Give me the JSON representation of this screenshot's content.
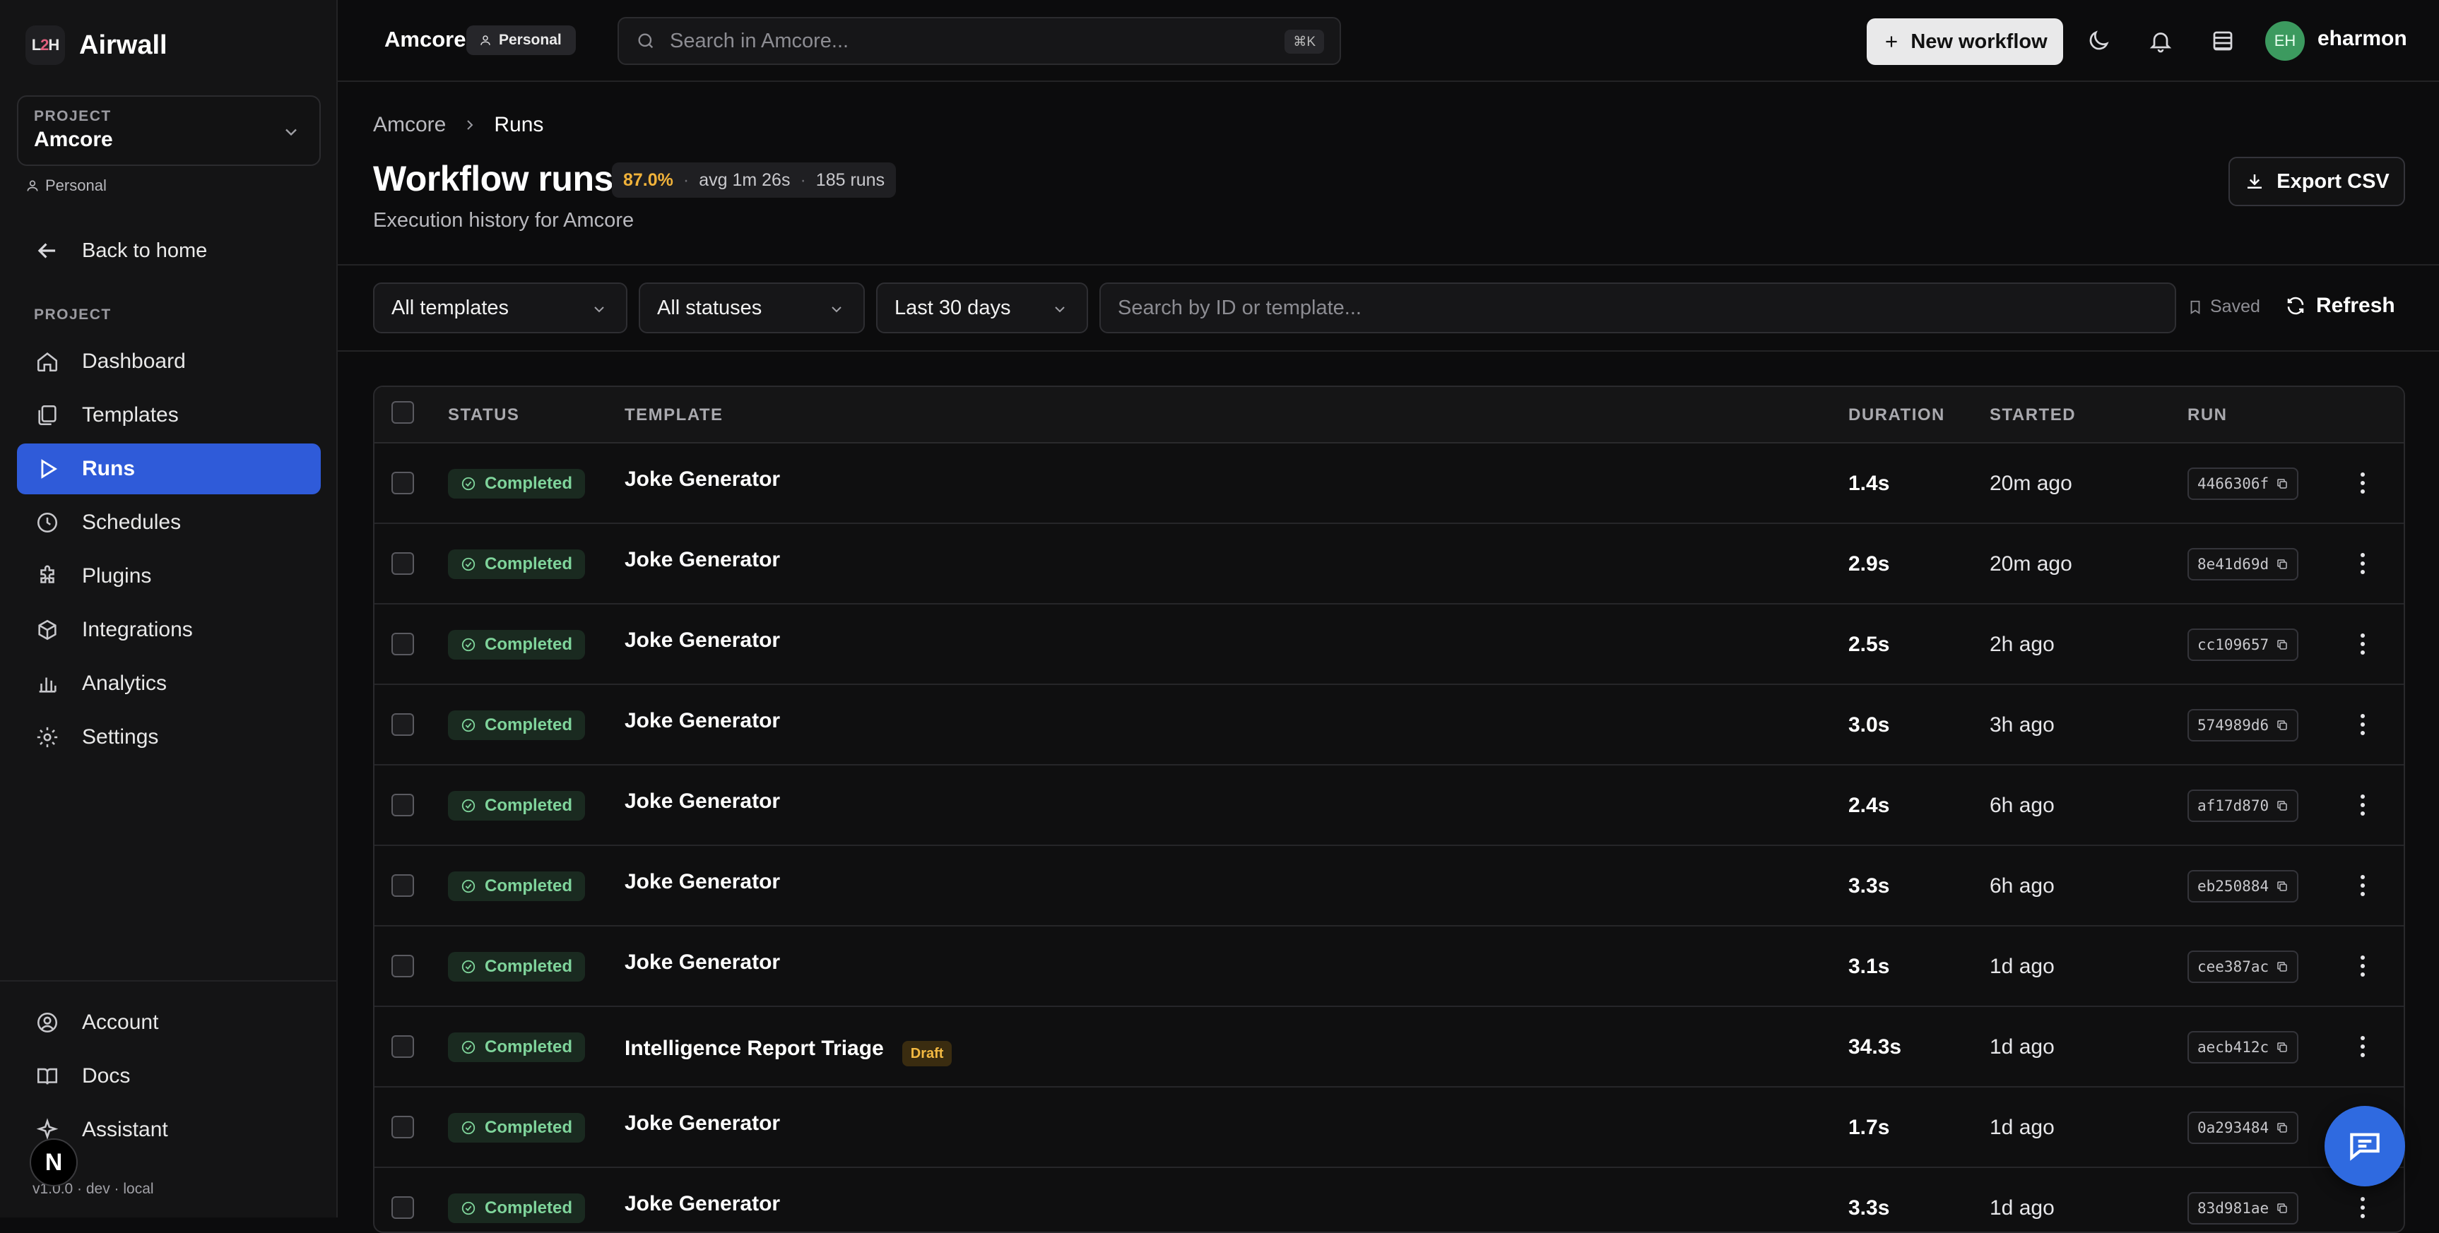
{
  "brand": {
    "logo_text": "L2H",
    "name": "Airwall"
  },
  "project_selector": {
    "label": "PROJECT",
    "value": "Amcore",
    "scope": "Personal"
  },
  "sidebar": {
    "back_label": "Back to home",
    "section_label": "PROJECT",
    "items": [
      {
        "label": "Dashboard",
        "icon": "home-icon"
      },
      {
        "label": "Templates",
        "icon": "templates-icon"
      },
      {
        "label": "Runs",
        "icon": "play-icon",
        "active": true
      },
      {
        "label": "Schedules",
        "icon": "clock-icon"
      },
      {
        "label": "Plugins",
        "icon": "puzzle-icon"
      },
      {
        "label": "Integrations",
        "icon": "cube-icon"
      },
      {
        "label": "Analytics",
        "icon": "bar-chart-icon"
      },
      {
        "label": "Settings",
        "icon": "gear-icon"
      }
    ],
    "bottom_items": [
      {
        "label": "Account",
        "icon": "user-circle-icon"
      },
      {
        "label": "Docs",
        "icon": "book-icon"
      },
      {
        "label": "Assistant",
        "icon": "sparkle-icon"
      }
    ],
    "version": "v1.0.0 · dev · local",
    "n_badge": "N"
  },
  "topbar": {
    "project": "Amcore",
    "personal_badge": "Personal",
    "search_placeholder": "Search in Amcore...",
    "search_shortcut": "⌘K",
    "new_workflow_label": "New workflow",
    "avatar_initials": "EH",
    "username": "eharmon"
  },
  "header": {
    "breadcrumb": [
      "Amcore",
      "Runs"
    ],
    "title": "Workflow runs",
    "stats": {
      "success_rate": "87.0%",
      "avg": "avg 1m 26s",
      "runs": "185 runs"
    },
    "subtitle": "Execution history for Amcore",
    "export_label": "Export CSV"
  },
  "filters": {
    "templates": "All templates",
    "statuses": "All statuses",
    "range": "Last 30 days",
    "search_placeholder": "Search by ID or template...",
    "saved_label": "Saved",
    "refresh_label": "Refresh"
  },
  "table": {
    "columns": [
      "STATUS",
      "TEMPLATE",
      "DURATION",
      "STARTED",
      "RUN"
    ],
    "rows": [
      {
        "status": "Completed",
        "template": "Joke Generator",
        "draft": "",
        "duration": "1.4s",
        "started": "20m ago",
        "run": "4466306f"
      },
      {
        "status": "Completed",
        "template": "Joke Generator",
        "draft": "",
        "duration": "2.9s",
        "started": "20m ago",
        "run": "8e41d69d"
      },
      {
        "status": "Completed",
        "template": "Joke Generator",
        "draft": "",
        "duration": "2.5s",
        "started": "2h ago",
        "run": "cc109657"
      },
      {
        "status": "Completed",
        "template": "Joke Generator",
        "draft": "",
        "duration": "3.0s",
        "started": "3h ago",
        "run": "574989d6"
      },
      {
        "status": "Completed",
        "template": "Joke Generator",
        "draft": "",
        "duration": "2.4s",
        "started": "6h ago",
        "run": "af17d870"
      },
      {
        "status": "Completed",
        "template": "Joke Generator",
        "draft": "",
        "duration": "3.3s",
        "started": "6h ago",
        "run": "eb250884"
      },
      {
        "status": "Completed",
        "template": "Joke Generator",
        "draft": "",
        "duration": "3.1s",
        "started": "1d ago",
        "run": "cee387ac"
      },
      {
        "status": "Completed",
        "template": "Intelligence Report Triage",
        "draft": "Draft",
        "duration": "34.3s",
        "started": "1d ago",
        "run": "aecb412c"
      },
      {
        "status": "Completed",
        "template": "Joke Generator",
        "draft": "",
        "duration": "1.7s",
        "started": "1d ago",
        "run": "0a293484"
      },
      {
        "status": "Completed",
        "template": "Joke Generator",
        "draft": "",
        "duration": "3.3s",
        "started": "1d ago",
        "run": "83d981ae"
      }
    ]
  },
  "colors": {
    "accent": "#2f5bd9",
    "success": "#7fd49b",
    "warning": "#f0b23a",
    "fab": "#2f6ae0"
  }
}
